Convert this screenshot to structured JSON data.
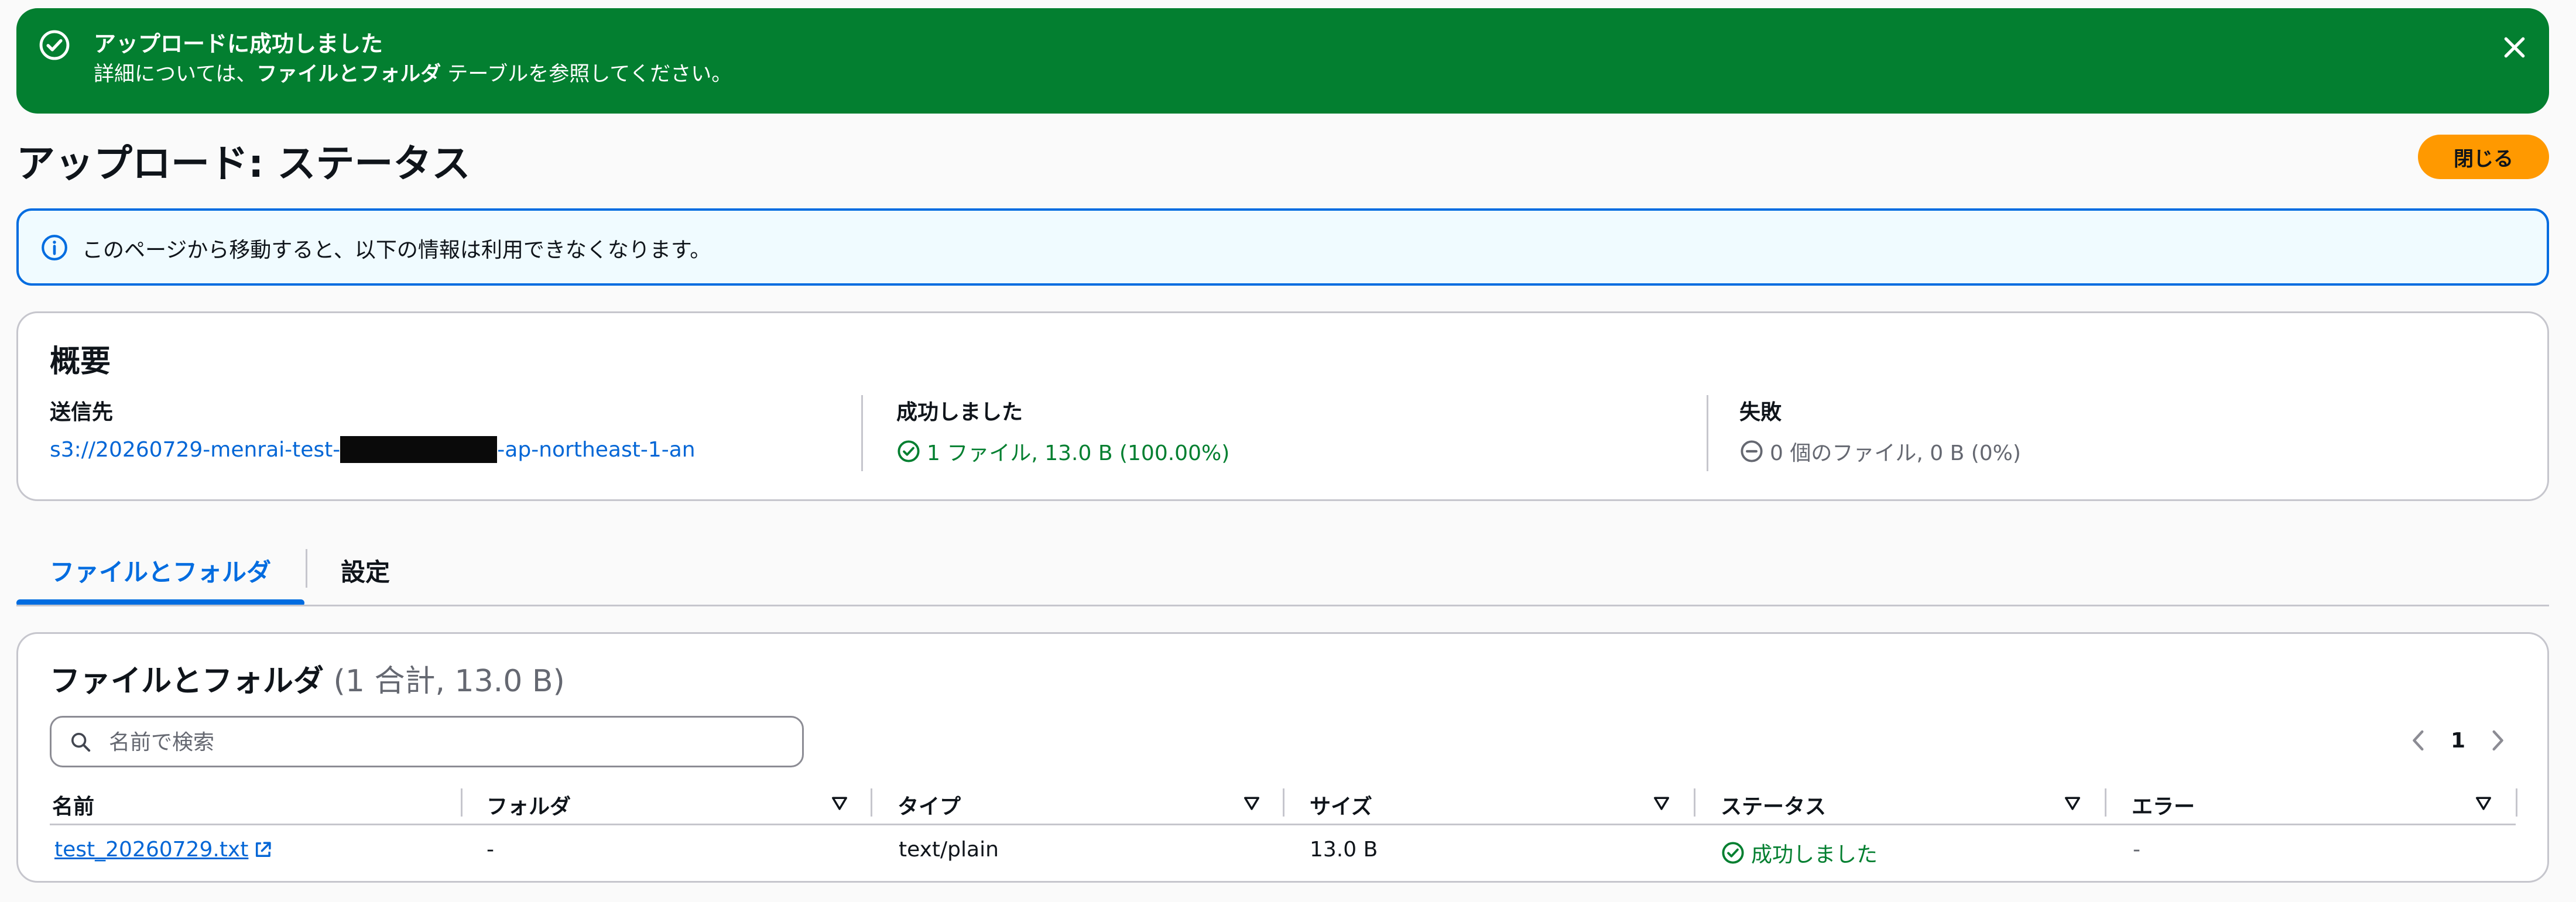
{
  "flash": {
    "title": "アップロードに成功しました",
    "message_prefix": "詳細については、",
    "message_bold": "ファイルとフォルダ",
    "message_suffix": " テーブルを参照してください。",
    "icons": {
      "status": "check-circle-icon",
      "close": "close-icon"
    }
  },
  "page": {
    "title": "アップロード: ステータス",
    "close_label": "閉じる"
  },
  "info": {
    "text": "このページから移動すると、以下の情報は利用できなくなります。",
    "icon": "info-icon"
  },
  "summary": {
    "heading": "概要",
    "destination": {
      "label": "送信先",
      "prefix": "s3://20260729-menrai-test-",
      "suffix": "-ap-northeast-1-an"
    },
    "succeeded": {
      "label": "成功しました",
      "value": "1 ファイル, 13.0 B (100.00%)",
      "icon": "check-circle-icon"
    },
    "failed": {
      "label": "失敗",
      "value": "0 個のファイル, 0 B (0%)",
      "icon": "minus-circle-icon"
    }
  },
  "tabs": [
    {
      "label": "ファイルとフォルダ",
      "active": true
    },
    {
      "label": "設定",
      "active": false
    }
  ],
  "files": {
    "title": "ファイルとフォルダ",
    "count": "(1 合計, 13.0 B)",
    "search_placeholder": "名前で検索",
    "pagination": {
      "current": "1"
    },
    "columns": [
      "名前",
      "フォルダ",
      "タイプ",
      "サイズ",
      "ステータス",
      "エラー"
    ],
    "rows": [
      {
        "name": "test_20260729.txt",
        "folder": "-",
        "type": "text/plain",
        "size": "13.0 B",
        "status": "成功しました",
        "error": "-"
      }
    ]
  },
  "colors": {
    "success": "#037f30",
    "link": "#0366d6",
    "primary_button": "#ff9900",
    "info_border": "#006ce0"
  }
}
